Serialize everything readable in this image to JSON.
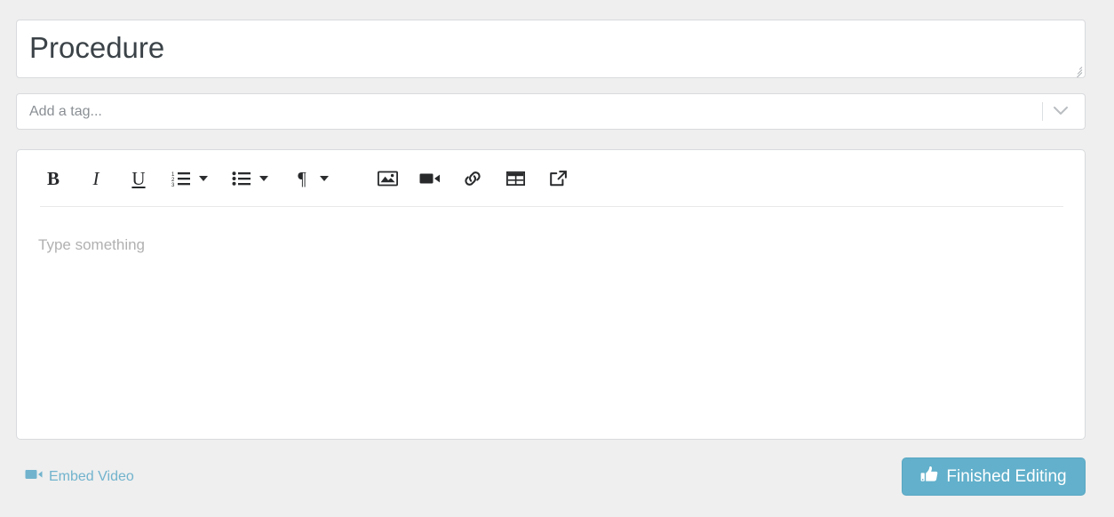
{
  "title_field": {
    "value": "Procedure",
    "resize_handle": "resize-grip-icon"
  },
  "tag_field": {
    "placeholder": "Add a tag...",
    "caret_icon": "chevron-down-icon"
  },
  "editor": {
    "placeholder": "Type something",
    "toolbar": [
      {
        "name": "bold-button",
        "label": "B",
        "style": "bold"
      },
      {
        "name": "italic-button",
        "label": "I",
        "style": "italic"
      },
      {
        "name": "underline-button",
        "label": "U",
        "style": "underline"
      },
      {
        "name": "ordered-list-button",
        "icon": "ordered-list-icon",
        "caret": true
      },
      {
        "name": "bullet-list-button",
        "icon": "bullet-list-icon",
        "caret": true
      },
      {
        "name": "paragraph-style-button",
        "label": "¶",
        "caret": true
      },
      {
        "name": "insert-image-button",
        "icon": "image-icon"
      },
      {
        "name": "insert-video-button",
        "icon": "video-camera-icon"
      },
      {
        "name": "insert-link-button",
        "icon": "link-icon"
      },
      {
        "name": "insert-table-button",
        "icon": "table-icon"
      },
      {
        "name": "popout-editor-button",
        "icon": "external-link-icon"
      }
    ]
  },
  "footer": {
    "embed_video_label": "Embed Video",
    "embed_video_icon": "video-camera-icon",
    "finish_label": "Finished Editing",
    "finish_icon": "thumbs-up-icon"
  },
  "colors": {
    "page_background": "#efefef",
    "field_background": "#ffffff",
    "field_border": "#d8dadd",
    "accent_blue": "#62b0cb",
    "link_blue": "#71b3cd",
    "title_text": "#3b4348",
    "placeholder_gray": "#b1b1b1",
    "tag_placeholder_gray": "#8a8f94",
    "toolbar_icon": "#27292b"
  }
}
